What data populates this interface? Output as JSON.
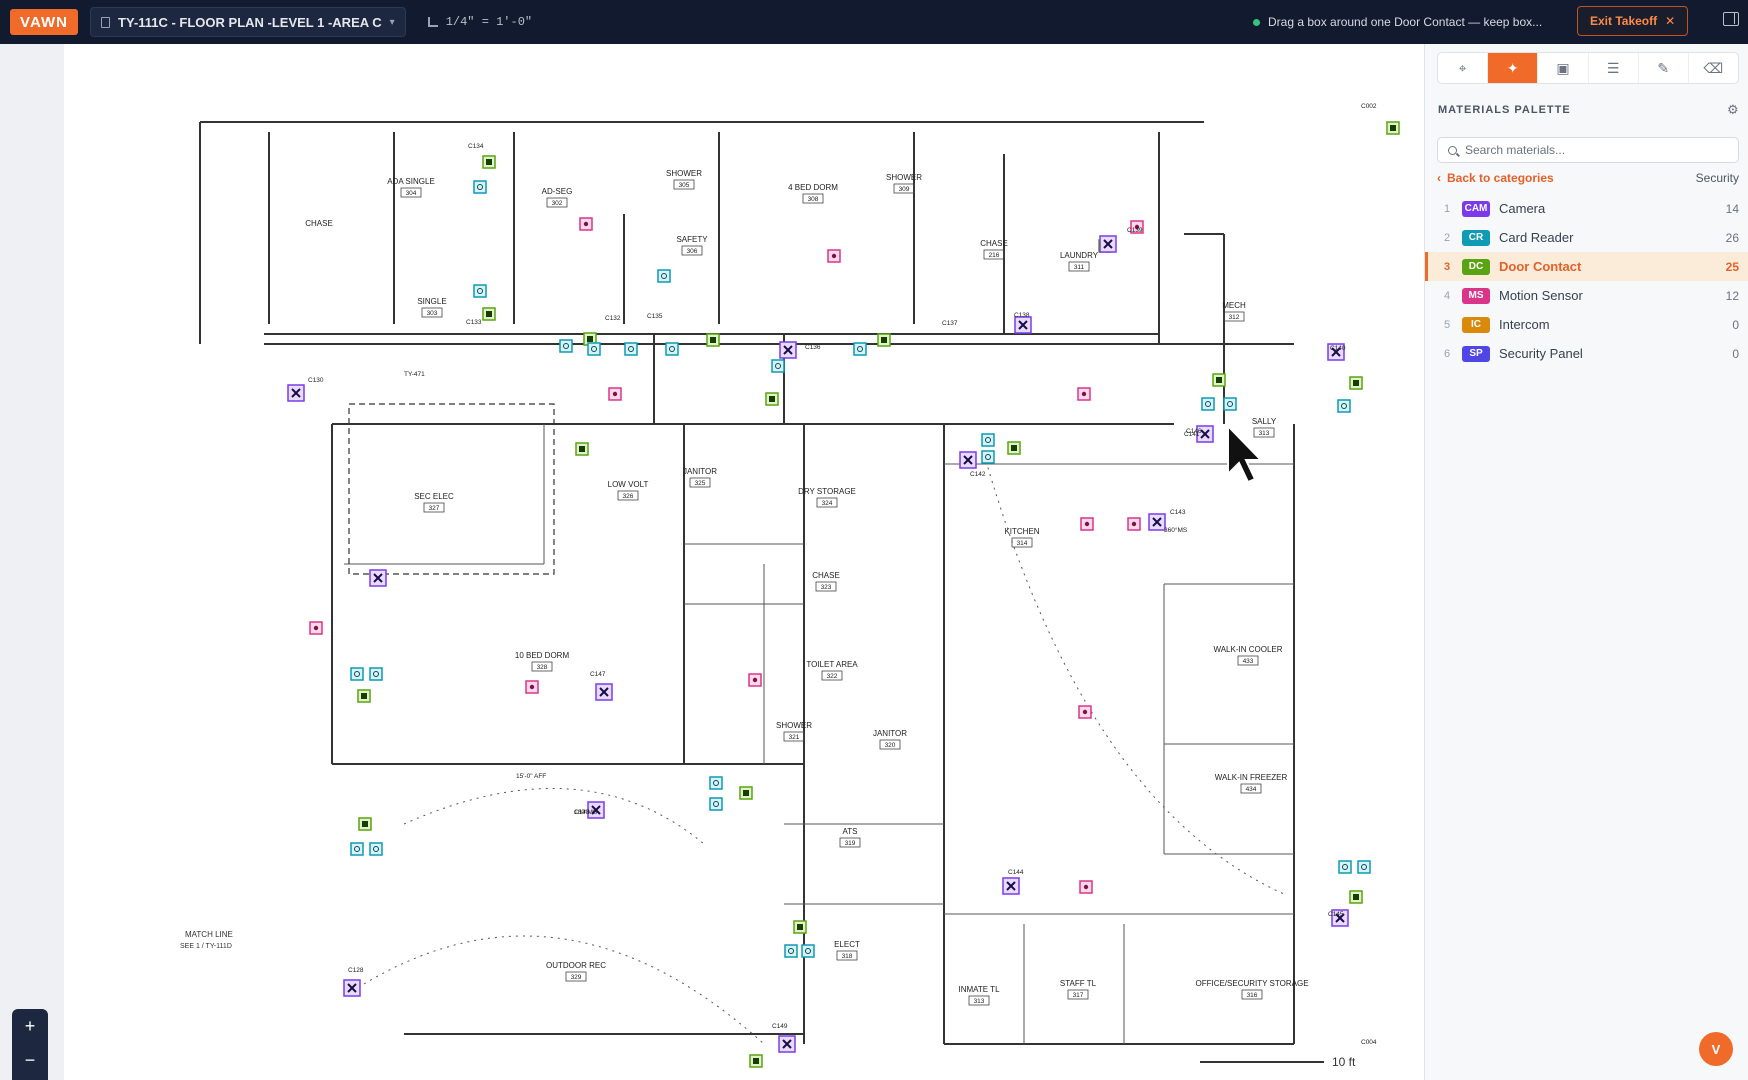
{
  "app": {
    "logo": "VAWN"
  },
  "header": {
    "sheet_title": "TY-111C - FLOOR PLAN -LEVEL 1 -AREA C",
    "scale": "1/4\" = 1'-0\"",
    "hint": "Drag a box around one Door Contact — keep box...",
    "exit_label": "Exit Takeoff"
  },
  "tools": [
    {
      "icon": "crosshair-icon",
      "active": false
    },
    {
      "icon": "magic-wand-icon",
      "active": true
    },
    {
      "icon": "image-icon",
      "active": false
    },
    {
      "icon": "table-icon",
      "active": false
    },
    {
      "icon": "pencil-icon",
      "active": false
    },
    {
      "icon": "eraser-icon",
      "active": false
    }
  ],
  "palette": {
    "title": "MATERIALS PALETTE",
    "search_placeholder": "Search materials...",
    "back_label": "Back to categories",
    "category": "Security",
    "items": [
      {
        "num": "1",
        "code": "CAM",
        "label": "Camera",
        "count": "14",
        "color": "#7c3aed"
      },
      {
        "num": "2",
        "code": "CR",
        "label": "Card Reader",
        "count": "26",
        "color": "#0e9bb3"
      },
      {
        "num": "3",
        "code": "DC",
        "label": "Door Contact",
        "count": "25",
        "color": "#5aa313",
        "selected": true
      },
      {
        "num": "4",
        "code": "MS",
        "label": "Motion Sensor",
        "count": "12",
        "color": "#d9368a"
      },
      {
        "num": "5",
        "code": "IC",
        "label": "Intercom",
        "count": "0",
        "color": "#d98a0b"
      },
      {
        "num": "6",
        "code": "SP",
        "label": "Security Panel",
        "count": "0",
        "color": "#4f46e5"
      }
    ]
  },
  "zoom": {
    "in": "+",
    "out": "−"
  },
  "user": {
    "initial": "V"
  },
  "plan": {
    "scale_bar": "10 ft",
    "match_line": "MATCH LINE",
    "match_line_ref": "SEE 1 / TY-111D",
    "rooms": [
      {
        "name": "ADA SINGLE",
        "num": "304"
      },
      {
        "name": "AD-SEG",
        "num": "302"
      },
      {
        "name": "SHOWER",
        "num": "305"
      },
      {
        "name": "SAFETY",
        "num": "306"
      },
      {
        "name": "4 BED DORM",
        "num": "308"
      },
      {
        "name": "SHOWER",
        "num": "309"
      },
      {
        "name": "SINGLE",
        "num": "303"
      },
      {
        "name": "CHASE",
        "num": ""
      },
      {
        "name": "CHASE",
        "num": "216"
      },
      {
        "name": "LAUNDRY",
        "num": "311"
      },
      {
        "name": "MECH",
        "num": "312"
      },
      {
        "name": "SALLY",
        "num": "313"
      },
      {
        "name": "SEC ELEC",
        "num": "327"
      },
      {
        "name": "LOW VOLT",
        "num": "326"
      },
      {
        "name": "JANITOR",
        "num": "325"
      },
      {
        "name": "DRY STORAGE",
        "num": "324"
      },
      {
        "name": "KITCHEN",
        "num": "314"
      },
      {
        "name": "CHASE",
        "num": "323"
      },
      {
        "name": "10 BED DORM",
        "num": "328"
      },
      {
        "name": "TOILET AREA",
        "num": "322"
      },
      {
        "name": "WALK-IN COOLER",
        "num": "433"
      },
      {
        "name": "WALK-IN FREEZER",
        "num": "434"
      },
      {
        "name": "SHOWER",
        "num": "321"
      },
      {
        "name": "JANITOR",
        "num": "320"
      },
      {
        "name": "ATS",
        "num": "319"
      },
      {
        "name": "ELECT",
        "num": "318"
      },
      {
        "name": "OUTDOOR REC",
        "num": "329"
      },
      {
        "name": "INMATE TL",
        "num": "313"
      },
      {
        "name": "STAFF TL",
        "num": "317"
      },
      {
        "name": "OFFICE/SECURITY STORAGE",
        "num": "316"
      }
    ],
    "tags": [
      "C134",
      "C133",
      "C132",
      "C135",
      "C136",
      "C137",
      "C138",
      "C139",
      "C130",
      "C140",
      "C141",
      "C142",
      "C143",
      "C144",
      "C145",
      "C146",
      "C147",
      "C148",
      "C149",
      "C128",
      "C002",
      "C004",
      "360°MS",
      "180°MS",
      "15'-0\" AFF",
      "TY-471"
    ]
  }
}
